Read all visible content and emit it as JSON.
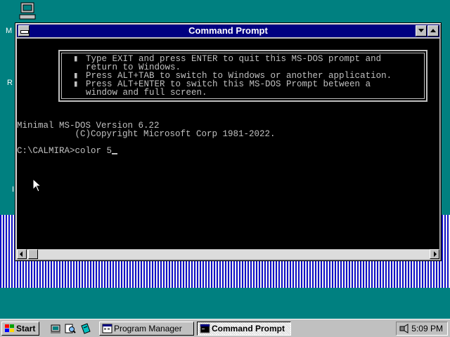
{
  "desktop": {
    "labels": [
      "M",
      "R",
      "I"
    ]
  },
  "window": {
    "title": "Command Prompt"
  },
  "console": {
    "notice_bullets": [
      "Type EXIT and press ENTER to quit this MS-DOS prompt and\nreturn to Windows.",
      "Press ALT+TAB to switch to Windows or another application.",
      "Press ALT+ENTER to switch this MS-DOS Prompt between a\nwindow and full screen."
    ],
    "bullet_mark": "▮",
    "version_line": "Minimal MS-DOS Version 6.22",
    "copyright_line": "           (C)Copyright Microsoft Corp 1981-2022.",
    "prompt": "C:\\CALMIRA>",
    "command": "color 5"
  },
  "taskbar": {
    "start_label": "Start",
    "tasks": [
      {
        "label": "Program Manager",
        "active": false
      },
      {
        "label": "Command Prompt",
        "active": true
      }
    ],
    "clock": "5:09 PM"
  },
  "colors": {
    "desktop": "#008080",
    "titlebar_active": "#000080",
    "console_bg": "#000000",
    "console_fg": "#c0c0c0",
    "stripe_blue": "#1010c8"
  },
  "icons": [
    "computer-icon",
    "system-menu-icon",
    "minimize-icon",
    "maximize-icon",
    "scroll-left-icon",
    "scroll-right-icon",
    "windows-flag-icon",
    "mouse-pointer-icon",
    "quick-launch-icons",
    "program-manager-icon",
    "command-prompt-icon",
    "speaker-tray-icon"
  ]
}
